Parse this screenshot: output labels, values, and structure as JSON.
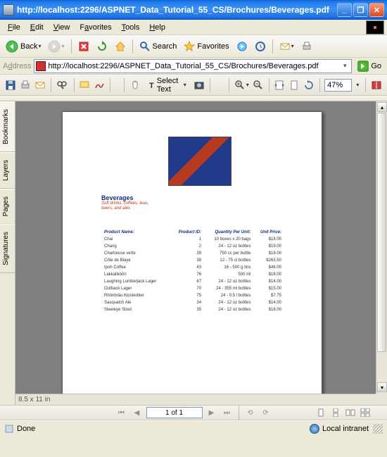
{
  "window": {
    "title": "http://localhost:2296/ASPNET_Data_Tutorial_55_CS/Brochures/Beverages.pdf"
  },
  "menu": {
    "file": "File",
    "edit": "Edit",
    "view": "View",
    "favorites": "Favorites",
    "tools": "Tools",
    "help": "Help"
  },
  "toolbar": {
    "back": "Back",
    "search": "Search",
    "favorites": "Favorites"
  },
  "address": {
    "label": "Address",
    "url": "http://localhost:2296/ASPNET_Data_Tutorial_55_CS/Brochures/Beverages.pdf",
    "go": "Go"
  },
  "pdf": {
    "select_text": "Select Text",
    "zoom": "47%"
  },
  "page_dims": "8.5 x 11 in",
  "navigator": {
    "page_of": "1 of 1"
  },
  "status": {
    "done": "Done",
    "zone": "Local intranet"
  },
  "sidetabs": {
    "bookmarks": "Bookmarks",
    "layers": "Layers",
    "pages": "Pages",
    "signatures": "Signatures"
  },
  "doc": {
    "title": "Beverages",
    "subtitle": "Soft drinks, coffees, teas, beers, and ales",
    "headers": [
      "Product Name:",
      "Product ID:",
      "Quantity Per Unit:",
      "Unit Price:"
    ]
  },
  "chart_data": {
    "type": "table",
    "title": "Beverages",
    "columns": [
      "Product Name",
      "Product ID",
      "Quantity Per Unit",
      "Unit Price"
    ],
    "rows": [
      {
        "name": "Chai",
        "id": 1,
        "qty": "10 boxes x 20 bags",
        "price": "$18.00"
      },
      {
        "name": "Chang",
        "id": 2,
        "qty": "24 - 12 oz bottles",
        "price": "$19.00"
      },
      {
        "name": "Chartreuse verte",
        "id": 39,
        "qty": "750 cc per bottle",
        "price": "$18.00"
      },
      {
        "name": "Côte de Blaye",
        "id": 38,
        "qty": "12 - 75 cl bottles",
        "price": "$263.50"
      },
      {
        "name": "Ipoh Coffee",
        "id": 43,
        "qty": "16 - 500 g tins",
        "price": "$46.00"
      },
      {
        "name": "Lakkalikööri",
        "id": 76,
        "qty": "500 ml",
        "price": "$18.00"
      },
      {
        "name": "Laughing Lumberjack Lager",
        "id": 67,
        "qty": "24 - 12 oz bottles",
        "price": "$14.00"
      },
      {
        "name": "Outback Lager",
        "id": 70,
        "qty": "24 - 355 ml bottles",
        "price": "$15.00"
      },
      {
        "name": "Rhönbräu Klosterbier",
        "id": 75,
        "qty": "24 - 0.5 l bottles",
        "price": "$7.75"
      },
      {
        "name": "Sasquatch Ale",
        "id": 34,
        "qty": "24 - 12 oz bottles",
        "price": "$14.00"
      },
      {
        "name": "Steeleye Stout",
        "id": 35,
        "qty": "24 - 12 oz bottles",
        "price": "$18.00"
      }
    ]
  }
}
